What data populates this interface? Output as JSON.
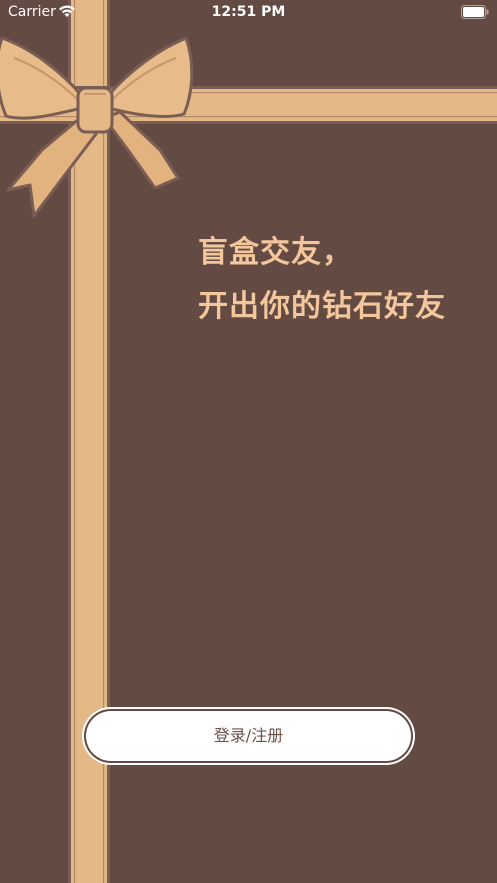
{
  "status_bar": {
    "carrier": "Carrier",
    "time": "12:51 PM",
    "wifi_icon": "wifi-icon",
    "battery_icon": "battery-icon"
  },
  "headline": {
    "line1": "盲盒交友，",
    "line2": "开出你的钻石好友"
  },
  "login_button": {
    "label": "登录/注册"
  },
  "colors": {
    "background": "#634b44",
    "ribbon": "#e5b887",
    "ribbon_edge": "#7a5e54",
    "headline": "#f3c69b",
    "button_text": "#6b5148"
  },
  "decoration": {
    "icon": "gift-ribbon-bow-icon"
  }
}
